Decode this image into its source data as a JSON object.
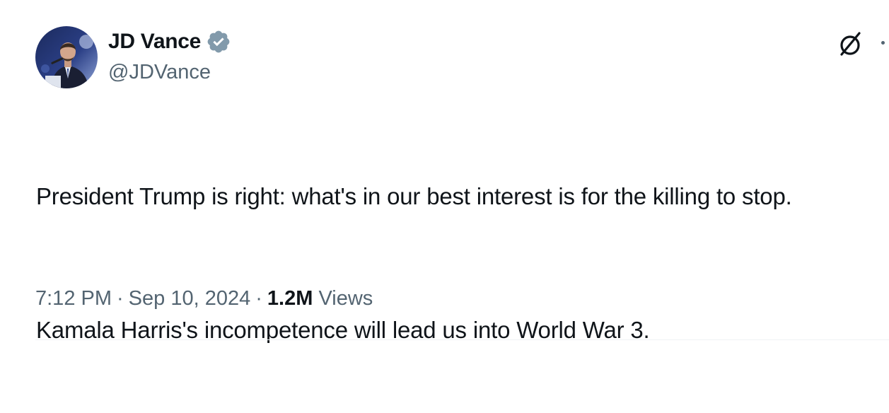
{
  "author": {
    "display_name": "JD Vance",
    "handle": "@JDVance",
    "verified": true,
    "avatar_icon": "profile-photo",
    "verified_icon": "verified-badge-icon",
    "verified_color": "#829aab"
  },
  "header_actions": {
    "grok_icon": "grok-icon",
    "more_icon": "more-options-icon"
  },
  "tweet": {
    "paragraphs": [
      "President Trump is right: what's in our best interest is for the killing to stop.",
      "Kamala Harris's incompetence will lead us into World War 3."
    ]
  },
  "meta": {
    "time": "7:12 PM",
    "separator": "·",
    "date": "Sep 10, 2024",
    "views_count": "1.2M",
    "views_label": "Views"
  },
  "colors": {
    "text_primary": "#0f1419",
    "text_secondary": "#536471",
    "divider": "#eff3f4"
  }
}
